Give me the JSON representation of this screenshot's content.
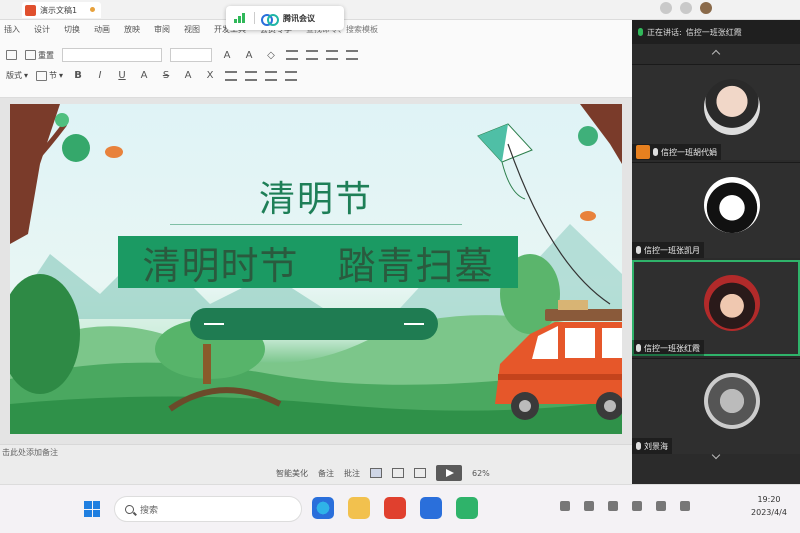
{
  "window": {
    "doc_tab_title": "演示文稿1"
  },
  "meeting_bar": {
    "app_name": "腾讯会议"
  },
  "ribbon": {
    "tabs": [
      "插入",
      "设计",
      "切换",
      "动画",
      "放映",
      "审阅",
      "视图",
      "开发工具",
      "会员专享"
    ],
    "search_text": "查找命令、搜索模板",
    "layout_label": "版式",
    "reset_label": "重置",
    "section_label": "节"
  },
  "slide": {
    "title": "清明节",
    "subtitle": "清明时节　踏青扫墓"
  },
  "statusbar": {
    "notes_hint": "击此处添加备注",
    "smart_beautify": "智能美化",
    "notes": "备注",
    "comments": "批注",
    "zoom": "62%"
  },
  "meeting_panel": {
    "speaking_prefix": "正在讲话:",
    "speaking_name": "信控一班张红霞",
    "participants": [
      {
        "name": "信控一班胡代娟",
        "host": true
      },
      {
        "name": "信控一班张凯月",
        "host": false
      },
      {
        "name": "信控一班张红霞",
        "host": false
      },
      {
        "name": "刘景海",
        "host": false
      }
    ]
  },
  "taskbar": {
    "search_placeholder": "搜索",
    "time": "19:20",
    "date": "2023/4/4"
  }
}
